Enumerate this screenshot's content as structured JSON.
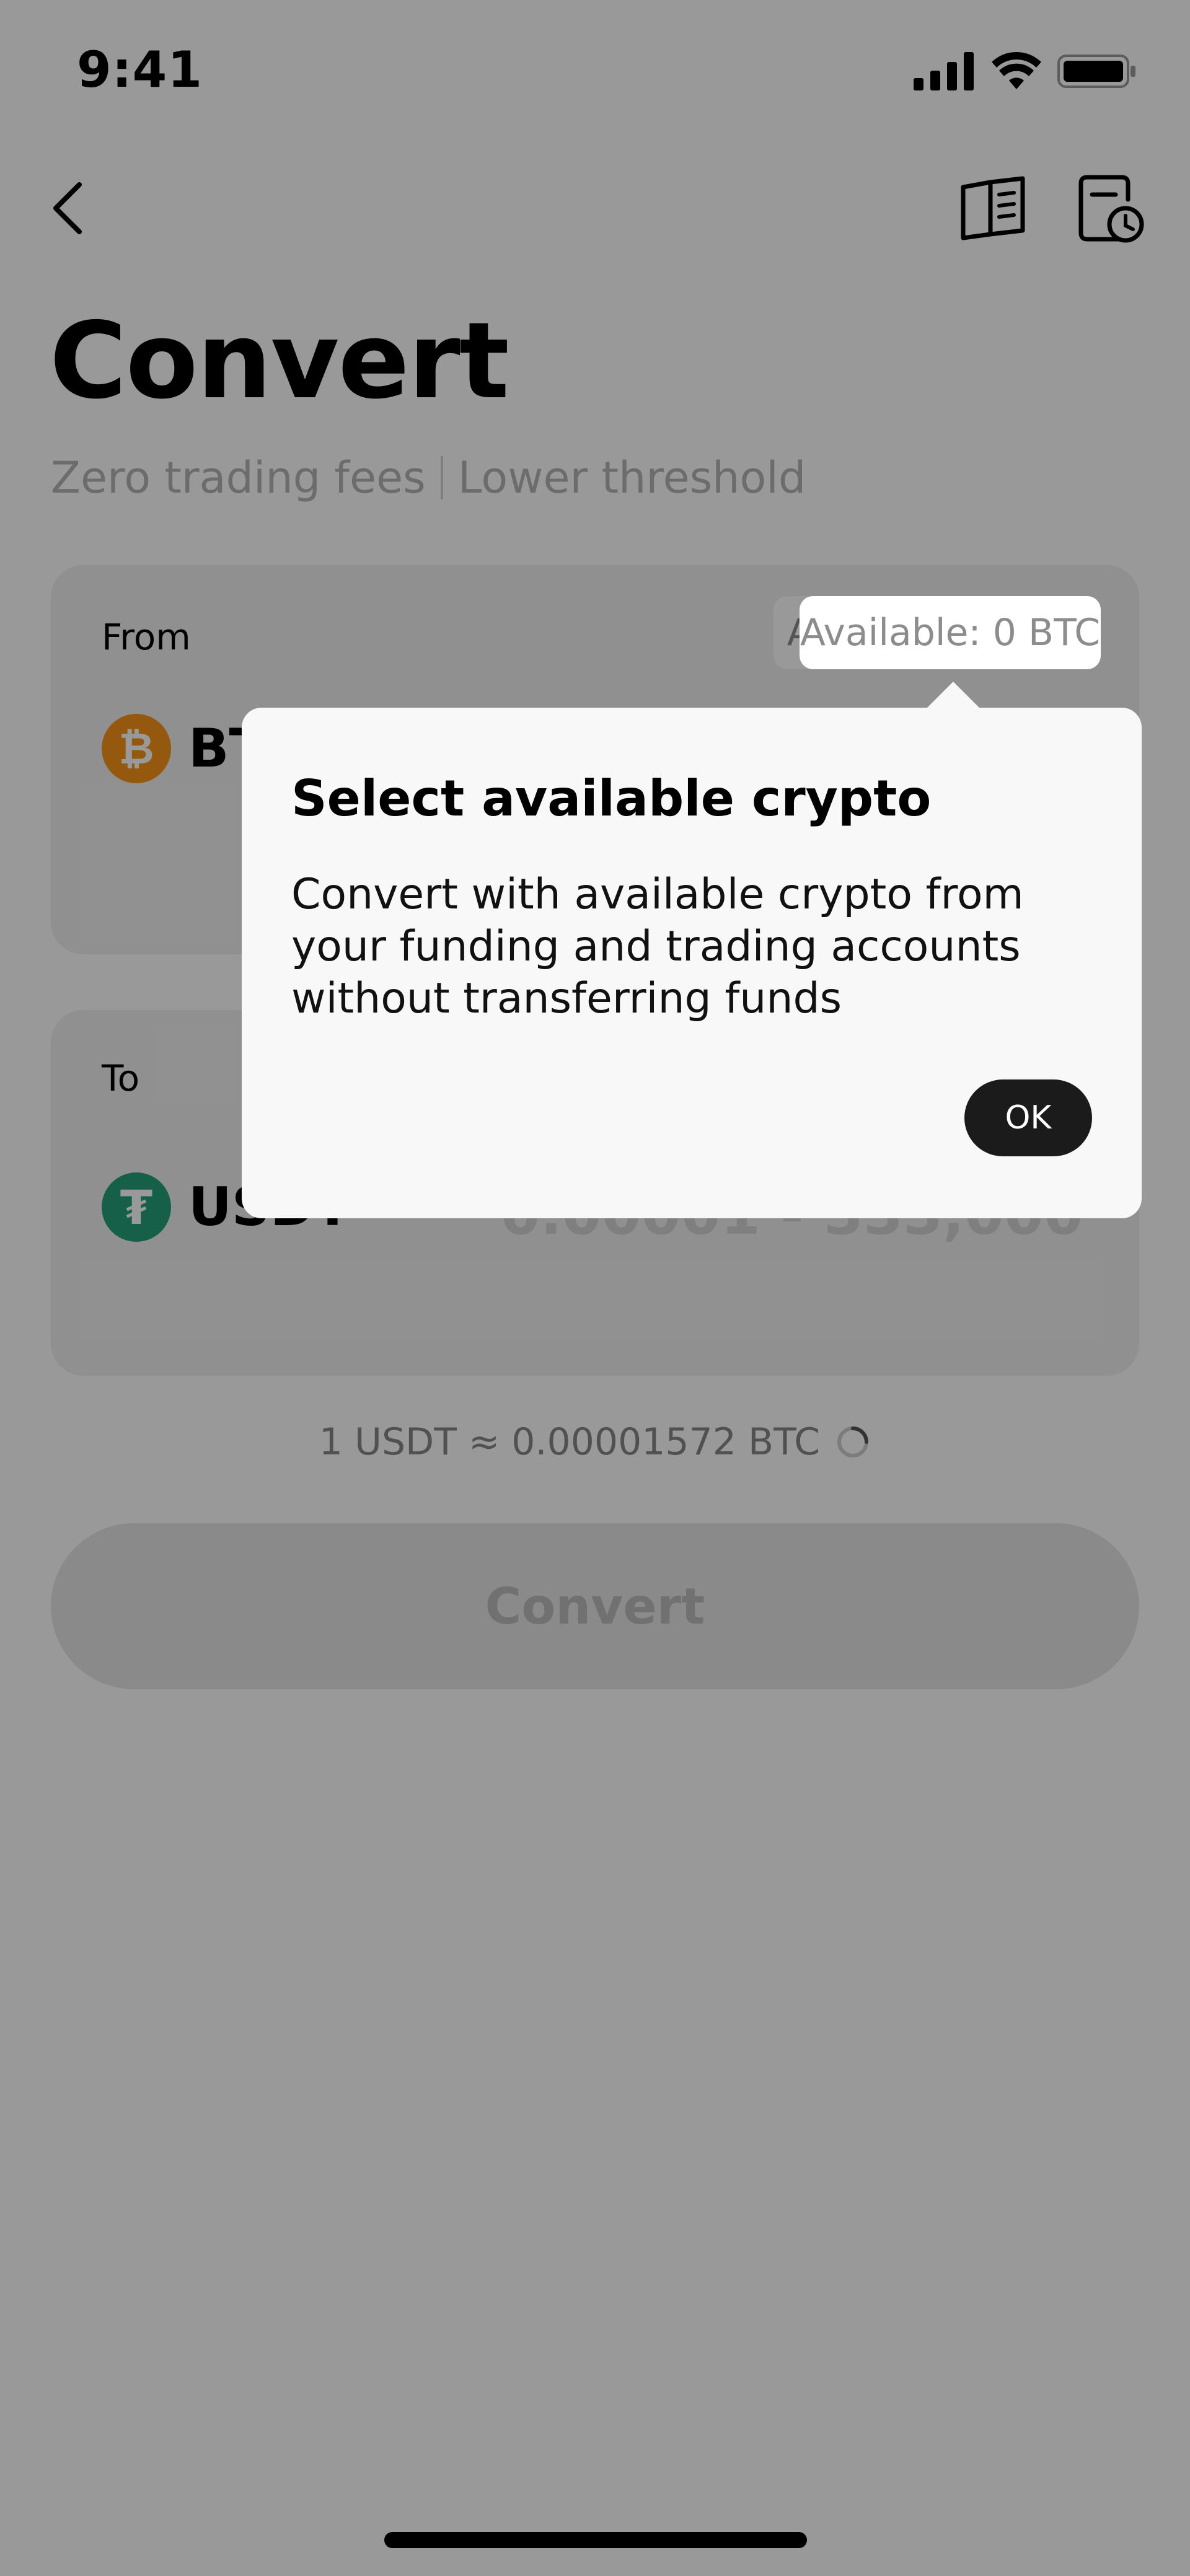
{
  "status_bar": {
    "time": "9:41"
  },
  "header": {
    "back_icon": "chevron-left-icon",
    "guide_icon": "book-icon",
    "history_icon": "clock-document-icon"
  },
  "page": {
    "title": "Convert",
    "subtitle_left": "Zero trading fees",
    "subtitle_right": "Lower threshold"
  },
  "from_card": {
    "label": "From",
    "available": "Available: 0 BTC",
    "coin": "BTC",
    "coin_icon": "bitcoin-icon",
    "coin_color": "#f7931a"
  },
  "to_card": {
    "label": "To",
    "coin": "USDT",
    "coin_icon": "tether-icon",
    "coin_color": "#26a17b",
    "amount_placeholder": "0.00001 - 333,000"
  },
  "rate": {
    "text": "1 USDT ≈ 0.00001572 BTC"
  },
  "convert_button": {
    "label": "Convert"
  },
  "popup": {
    "title": "Select available crypto",
    "body": "Convert with available crypto from your funding and trading accounts without transferring funds",
    "ok_label": "OK"
  }
}
